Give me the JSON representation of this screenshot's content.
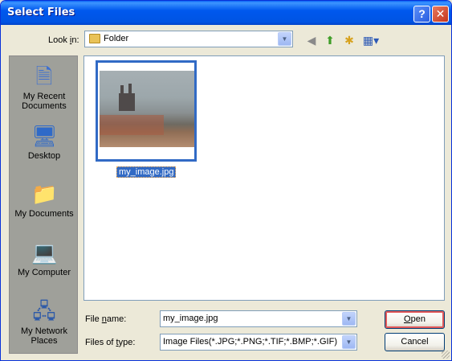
{
  "window": {
    "title": "Select Files"
  },
  "titlebar": {
    "help_label": "?",
    "close_label": "✕"
  },
  "lookin": {
    "label_prefix": "Look ",
    "label_underline": "i",
    "label_suffix": "n:",
    "value": "Folder"
  },
  "places": [
    {
      "id": "recent",
      "line1": "My Recent",
      "line2": "Documents",
      "icon": "recent-documents-icon",
      "glyph": "🗎"
    },
    {
      "id": "desktop",
      "line1": "Desktop",
      "line2": "",
      "icon": "desktop-icon",
      "glyph": "🖥"
    },
    {
      "id": "documents",
      "line1": "My Documents",
      "line2": "",
      "icon": "my-documents-icon",
      "glyph": "📁"
    },
    {
      "id": "computer",
      "line1": "My Computer",
      "line2": "",
      "icon": "my-computer-icon",
      "glyph": "💻"
    },
    {
      "id": "network",
      "line1": "My Network",
      "line2": "Places",
      "icon": "my-network-icon",
      "glyph": "🖧"
    }
  ],
  "files": [
    {
      "name": "my_image.jpg",
      "selected": true
    }
  ],
  "filename": {
    "label_prefix": "File ",
    "label_underline": "n",
    "label_suffix": "ame:",
    "value": "my_image.jpg"
  },
  "filetype": {
    "label_prefix": "Files of ",
    "label_underline": "t",
    "label_suffix": "ype:",
    "value": "Image Files(*.JPG;*.PNG;*.TIF;*.BMP;*.GIF)"
  },
  "buttons": {
    "open_underline": "O",
    "open_rest": "pen",
    "cancel": "Cancel"
  },
  "toolbar": {
    "back_glyph": "◀",
    "up_glyph": "⬆",
    "new_folder_glyph": "✱",
    "views_glyph": "▦▾"
  },
  "colors": {
    "accent": "#316AC5",
    "titlebar": "#0054E3",
    "dialog_bg": "#ECE9D8"
  }
}
